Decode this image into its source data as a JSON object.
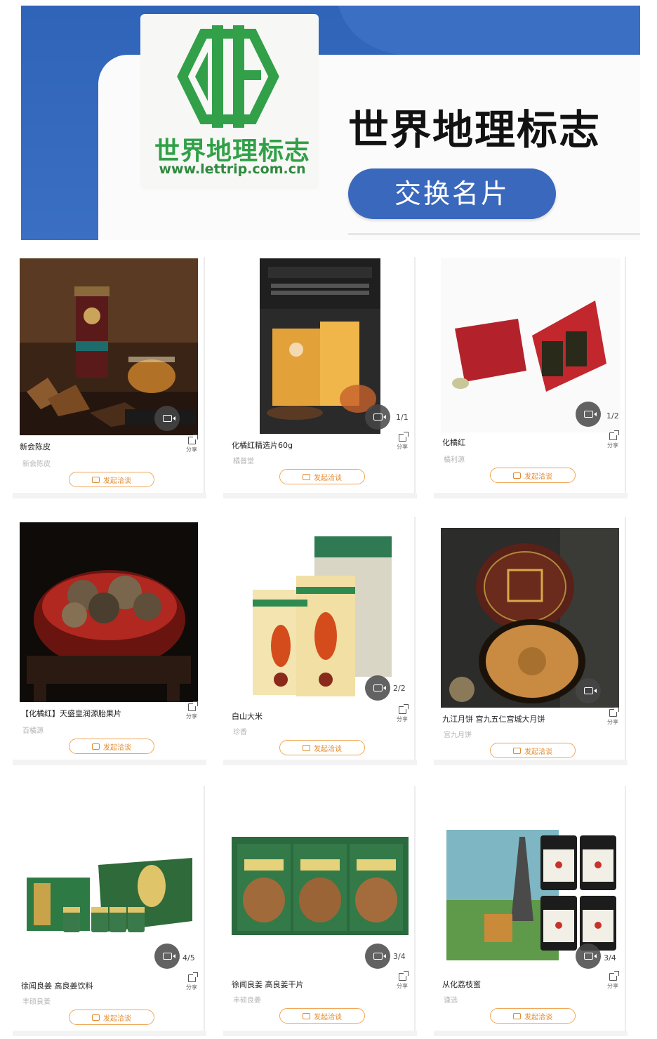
{
  "banner": {
    "logo_name": "世界地理标志",
    "logo_url": "www.lettrip.com.cn",
    "title": "世界地理标志",
    "exchange_button": "交换名片",
    "colors": {
      "banner_blue": "#2f64b9",
      "logo_green": "#31a048",
      "button_blue": "#3a68bd"
    }
  },
  "labels": {
    "share": "分享",
    "deal": "发起洽谈"
  },
  "colors": {
    "deal_orange": "#e38a2d"
  },
  "products": [
    {
      "title": "新会陈皮",
      "subtitle": "新会陈皮",
      "page_count": ""
    },
    {
      "title": "化橘红精选片60g",
      "subtitle": "橘普堂",
      "page_count": "1/1"
    },
    {
      "title": "化橘红",
      "subtitle": "橘利源",
      "page_count": "1/2"
    },
    {
      "title": "【化橘红】天盛皇润源胎果片",
      "subtitle": "百橘源",
      "page_count": ""
    },
    {
      "title": "白山大米",
      "subtitle": "珍香",
      "page_count": "2/2"
    },
    {
      "title": "九江月饼 宫九五仁宫城大月饼",
      "subtitle": "宫九月饼",
      "page_count": ""
    },
    {
      "title": "徐闻良姜 高良姜饮料",
      "subtitle": "丰硕良姜",
      "page_count": "4/5"
    },
    {
      "title": "徐闻良姜 高良姜干片",
      "subtitle": "丰硕良姜",
      "page_count": "3/4"
    },
    {
      "title": "从化荔枝蜜",
      "subtitle": "谨选",
      "page_count": "3/4"
    }
  ]
}
